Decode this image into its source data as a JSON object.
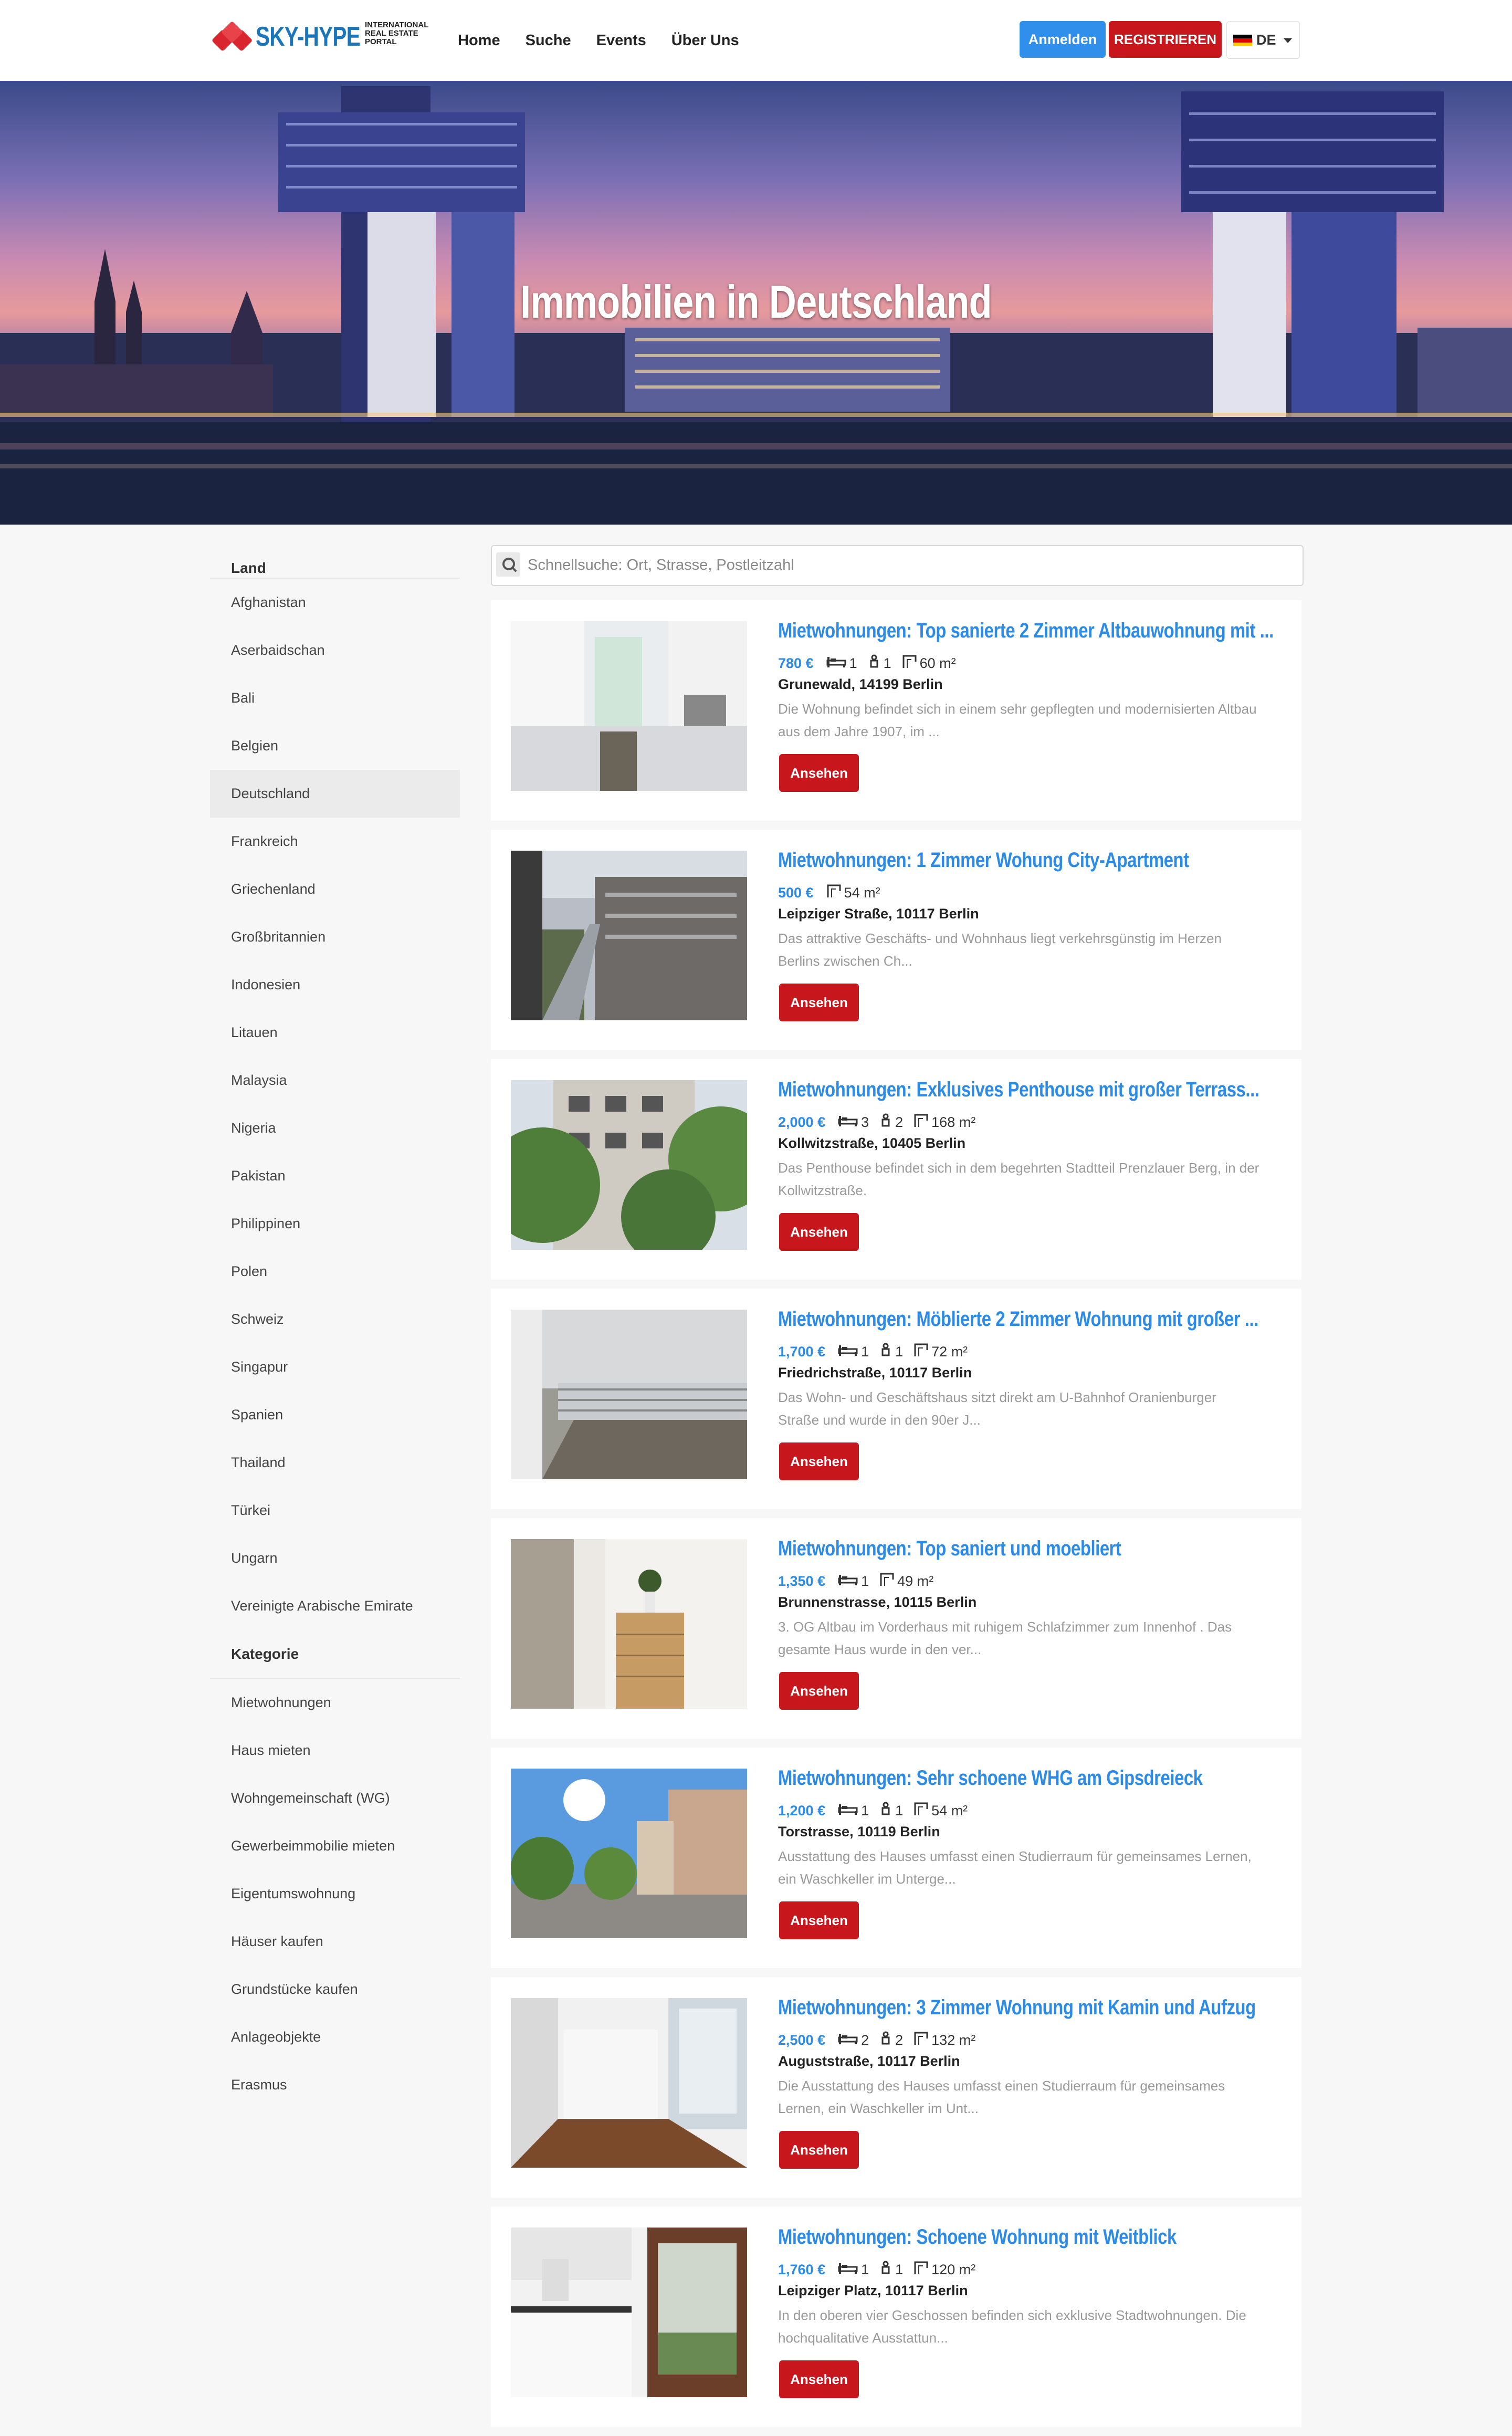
{
  "brand": {
    "name": "SKY-HYPE",
    "mini": "SKY",
    "tagline": [
      "INTERNATIONAL",
      "REAL ESTATE",
      "PORTAL"
    ],
    "color": "#1b75bb",
    "accent": "#d9262e"
  },
  "nav": {
    "links": [
      "Home",
      "Suche",
      "Events",
      "Über Uns"
    ],
    "login": "Anmelden",
    "register": "REGISTRIEREN",
    "language": "DE"
  },
  "hero": {
    "title": "Immobilien in Deutschland"
  },
  "search": {
    "placeholder": "Schnellsuche: Ort, Strasse, Postleitzahl"
  },
  "sidebar": {
    "country_heading": "Land",
    "countries": [
      "Afghanistan",
      "Aserbaidschan",
      "Bali",
      "Belgien",
      "Deutschland",
      "Frankreich",
      "Griechenland",
      "Großbritannien",
      "Indonesien",
      "Litauen",
      "Malaysia",
      "Nigeria",
      "Pakistan",
      "Philippinen",
      "Polen",
      "Schweiz",
      "Singapur",
      "Spanien",
      "Thailand",
      "Türkei",
      "Ungarn",
      "Vereinigte Arabische Emirate"
    ],
    "active_country": "Deutschland",
    "category_heading": "Kategorie",
    "categories": [
      "Mietwohnungen",
      "Haus mieten",
      "Wohngemeinschaft (WG)",
      "Gewerbeimmobilie mieten",
      "Eigentumswohnung",
      "Häuser kaufen",
      "Grundstücke kaufen",
      "Anlageobjekte",
      "Erasmus"
    ]
  },
  "listings": [
    {
      "title": "Mietwohnungen: Top sanierte 2 Zimmer Altbauwohnung mit ...",
      "price": "780 €",
      "beds": "1",
      "baths": "1",
      "area": "60 m²",
      "address": "Grunewald, 14199 Berlin",
      "description": "Die Wohnung befindet sich in einem sehr gepflegten und modernisierten Altbau aus dem Jahre 1907, im ...",
      "button": "Ansehen",
      "image": "kitchen-white"
    },
    {
      "title": "Mietwohnungen: 1 Zimmer Wohung City-Apartment",
      "price": "500 €",
      "beds": "",
      "baths": "",
      "area": "54 m²",
      "address": "Leipziger Straße, 10117 Berlin",
      "description": "Das attraktive Geschäfts- und Wohnhaus liegt verkehrsgünstig im Herzen Berlins zwischen Ch...",
      "button": "Ansehen",
      "image": "balcony-street"
    },
    {
      "title": "Mietwohnungen: Exklusives Penthouse mit großer Terrass...",
      "price": "2,000 €",
      "beds": "3",
      "baths": "2",
      "area": "168 m²",
      "address": "Kollwitzstraße, 10405 Berlin",
      "description": "Das Penthouse befindet sich in dem begehrten Stadtteil Prenzlauer Berg, in der Kollwitzstraße.",
      "button": "Ansehen",
      "image": "facade-trees"
    },
    {
      "title": "Mietwohnungen: Möblierte 2 Zimmer Wohnung mit großer ...",
      "price": "1,700 €",
      "beds": "1",
      "baths": "1",
      "area": "72 m²",
      "address": "Friedrichstraße, 10117 Berlin",
      "description": "Das Wohn- und Geschäftshaus sitzt direkt am U-Bahnhof Oranienburger Straße und wurde in den 90er J...",
      "button": "Ansehen",
      "image": "terrace"
    },
    {
      "title": "Mietwohnungen: Top saniert und moebliert",
      "price": "1,350 €",
      "beds": "1",
      "baths": "",
      "area": "49 m²",
      "address": "Brunnenstrasse, 10115 Berlin",
      "description": "3. OG Altbau im Vorderhaus mit ruhigem Schlafzimmer zum Innenhof . Das gesamte Haus wurde in den ver...",
      "button": "Ansehen",
      "image": "dresser"
    },
    {
      "title": "Mietwohnungen: Sehr schoene WHG am Gipsdreieck",
      "price": "1,200 €",
      "beds": "1",
      "baths": "1",
      "area": "54 m²",
      "address": "Torstrasse, 10119 Berlin",
      "description": "Ausstattung des Hauses umfasst einen Studierraum für gemeinsames Lernen, ein Waschkeller im Unterge...",
      "button": "Ansehen",
      "image": "street-sun"
    },
    {
      "title": "Mietwohnungen: 3 Zimmer Wohnung mit Kamin und Aufzug",
      "price": "2,500 €",
      "beds": "2",
      "baths": "2",
      "area": "132 m²",
      "address": "Auguststraße, 10117 Berlin",
      "description": "Die Ausstattung des Hauses umfasst einen Studierraum für gemeinsames Lernen, ein Waschkeller im Unt...",
      "button": "Ansehen",
      "image": "empty-room"
    },
    {
      "title": "Mietwohnungen: Schoene Wohnung mit Weitblick",
      "price": "1,760 €",
      "beds": "1",
      "baths": "1",
      "area": "120 m²",
      "address": "Leipziger Platz, 10117 Berlin",
      "description": "In den oberen vier Geschossen befinden sich exklusive Stadtwohnungen. Die hochqualitative Ausstattun...",
      "button": "Ansehen",
      "image": "kitchen-window"
    }
  ]
}
